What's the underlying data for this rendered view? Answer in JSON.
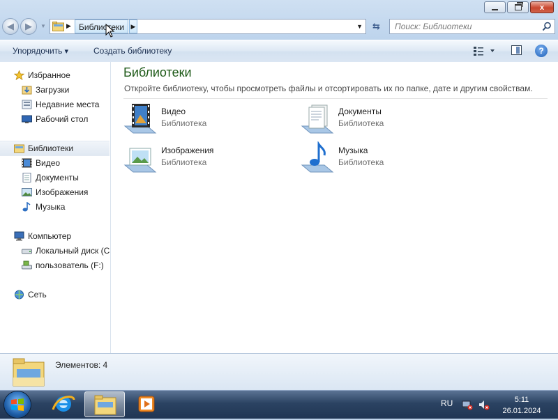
{
  "window": {
    "controls": {
      "minimize_icon": "minimize-icon",
      "maximize_icon": "restore-icon",
      "close_label": "x"
    }
  },
  "address_bar": {
    "breadcrumb": "Библиотеки",
    "search_placeholder": "Поиск: Библиотеки"
  },
  "toolbar": {
    "organize_label": "Упорядочить",
    "new_library_label": "Создать библиотеку"
  },
  "nav_pane": {
    "favorites": {
      "label": "Избранное",
      "items": [
        "Загрузки",
        "Недавние места",
        "Рабочий стол"
      ]
    },
    "libraries": {
      "label": "Библиотеки",
      "items": [
        "Видео",
        "Документы",
        "Изображения",
        "Музыка"
      ]
    },
    "computer": {
      "label": "Компьютер",
      "items": [
        "Локальный диск (C",
        "пользователь (F:)"
      ]
    },
    "network": {
      "label": "Сеть"
    }
  },
  "content": {
    "title": "Библиотеки",
    "subtitle": "Откройте библиотеку, чтобы просмотреть файлы и отсортировать их по папке, дате и другим свойствам.",
    "libraries": [
      {
        "name": "Видео",
        "kind": "Библиотека",
        "icon": "video-library-icon"
      },
      {
        "name": "Документы",
        "kind": "Библиотека",
        "icon": "documents-library-icon"
      },
      {
        "name": "Изображения",
        "kind": "Библиотека",
        "icon": "pictures-library-icon"
      },
      {
        "name": "Музыка",
        "kind": "Библиотека",
        "icon": "music-library-icon"
      }
    ]
  },
  "status": {
    "items_count": "Элементов: 4"
  },
  "taskbar": {
    "language": "RU",
    "time": "5:11",
    "date": "26.01.2024",
    "colors": {
      "accent": "#1e5a18",
      "taskbar": "#2b4362"
    }
  }
}
